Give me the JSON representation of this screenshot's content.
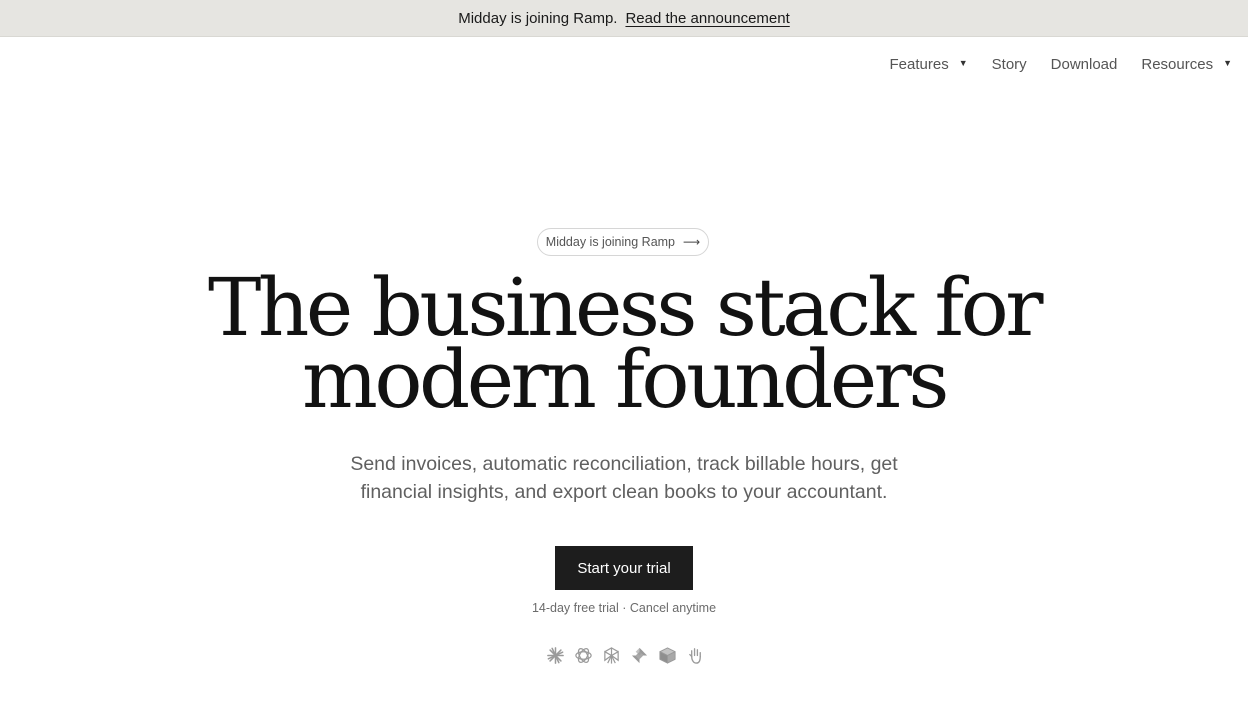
{
  "banner": {
    "message": "Midday is joining Ramp.",
    "link_label": "Read the announcement"
  },
  "nav": {
    "items": [
      {
        "label": "Features",
        "has_dropdown": true
      },
      {
        "label": "Story",
        "has_dropdown": false
      },
      {
        "label": "Download",
        "has_dropdown": false
      },
      {
        "label": "Resources",
        "has_dropdown": true
      }
    ]
  },
  "hero": {
    "pill_label": "Midday is joining Ramp",
    "headline_line1": "The business stack for",
    "headline_line2": "modern founders",
    "subtitle": "Send invoices, automatic reconciliation, track billable hours, get financial insights, and export clean books to your accountant.",
    "cta_label": "Start your trial",
    "note": "14-day free trial · Cancel anytime"
  },
  "logos": [
    {
      "icon": "claude-icon"
    },
    {
      "icon": "openai-icon"
    },
    {
      "icon": "perplexity-icon"
    },
    {
      "icon": "raycast-icon"
    },
    {
      "icon": "cube-icon"
    },
    {
      "icon": "hand-icon"
    }
  ],
  "colors": {
    "banner_bg": "#e6e5e1",
    "cta_bg": "#1d1d1d",
    "text_primary": "#121212",
    "text_muted": "#606060"
  }
}
